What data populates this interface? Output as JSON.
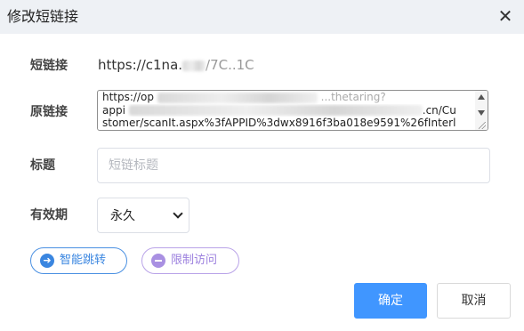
{
  "dialog": {
    "title": "修改短链接",
    "close_glyph": "✕"
  },
  "form": {
    "short_label": "短链接",
    "short_value_prefix": "https://c1na.",
    "short_value_suffix": "/7C..1C",
    "original_label": "原链接",
    "original_lines": [
      "https://op",
      "appi",
      "stomer/scanIt.aspx%3fAPPID%3dwx8916f3ba018e9591%26fInterl"
    ],
    "original_line1_tail": "...thetaring?",
    "original_line2_tail": ".cn/Cu",
    "title_label": "标题",
    "title_placeholder": "短链标题",
    "title_value": "",
    "expiry_label": "有效期",
    "expiry_value": "永久"
  },
  "actions": {
    "smart_jump": "智能跳转",
    "limit_access": "限制访问",
    "confirm": "确定",
    "cancel": "取消"
  },
  "colors": {
    "primary": "#4096ff",
    "smart_pill": "#3a86e0",
    "limit_pill": "#9b7fde",
    "header_bg": "#eef1f5"
  },
  "icons": {
    "close": "close-icon",
    "smart": "arrow-right-circle-icon",
    "limit": "minus-circle-icon"
  }
}
